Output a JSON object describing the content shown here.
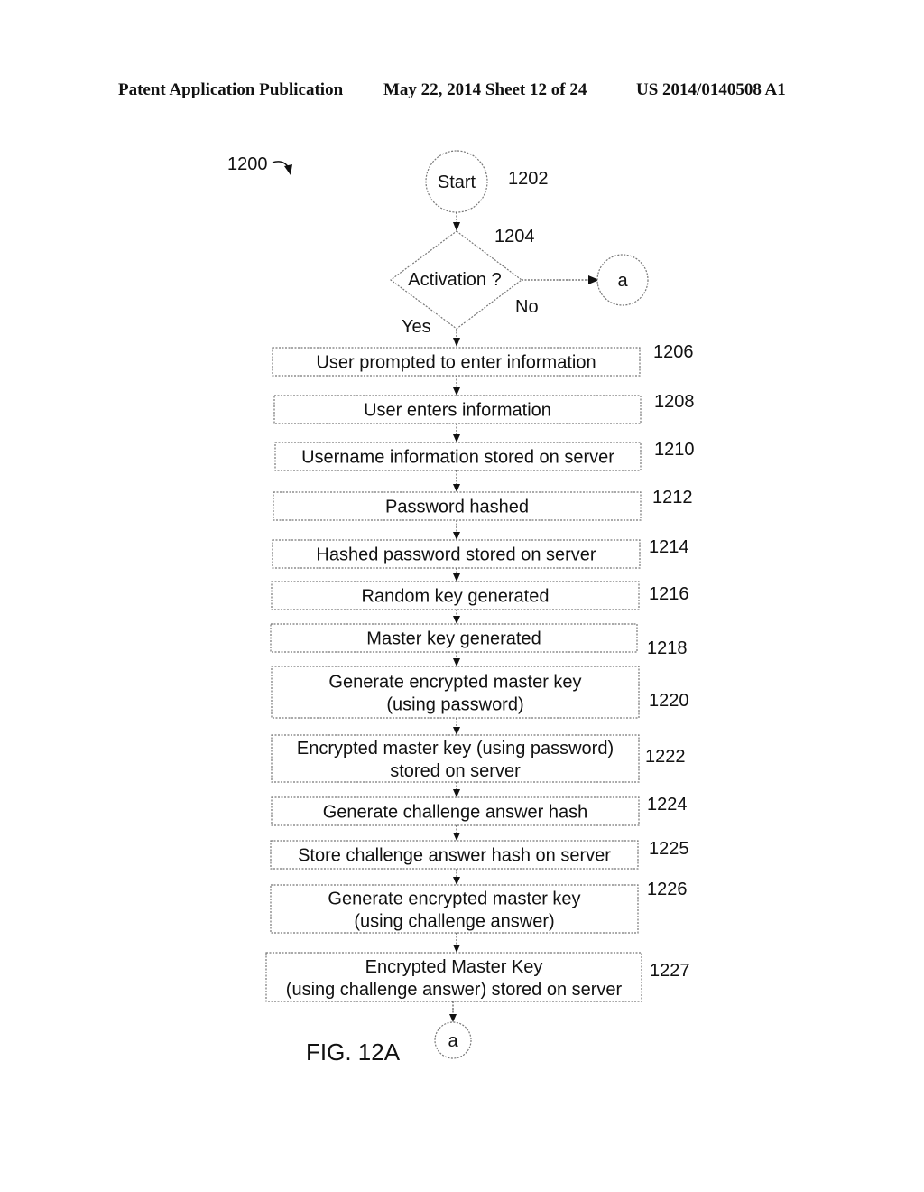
{
  "header": {
    "publication": "Patent Application Publication",
    "date_sheet": "May 22, 2014  Sheet 12 of 24",
    "number": "US 2014/0140508 A1"
  },
  "figure": {
    "label": "FIG. 12A",
    "ref": "1200",
    "start": {
      "text": "Start",
      "ref": "1202"
    },
    "decision": {
      "text": "Activation ?",
      "ref": "1204",
      "yes": "Yes",
      "no": "No"
    },
    "connector_no": "a",
    "connector_end": "a",
    "steps": [
      {
        "ref": "1206",
        "lines": [
          "User prompted to enter information"
        ]
      },
      {
        "ref": "1208",
        "lines": [
          "User enters information"
        ]
      },
      {
        "ref": "1210",
        "lines": [
          "Username information stored on server"
        ]
      },
      {
        "ref": "1212",
        "lines": [
          "Password hashed"
        ]
      },
      {
        "ref": "1214",
        "lines": [
          "Hashed password stored on server"
        ]
      },
      {
        "ref": "1216",
        "lines": [
          "Random key generated"
        ]
      },
      {
        "ref": "1218",
        "lines": [
          "Master key generated"
        ]
      },
      {
        "ref": "1220",
        "lines": [
          "Generate encrypted master key",
          "(using password)"
        ]
      },
      {
        "ref": "1222",
        "lines": [
          "Encrypted master key (using password)",
          "stored on server"
        ]
      },
      {
        "ref": "1224",
        "lines": [
          "Generate challenge answer hash"
        ]
      },
      {
        "ref": "1225",
        "lines": [
          "Store challenge answer hash on server"
        ]
      },
      {
        "ref": "1226",
        "lines": [
          "Generate encrypted master key",
          "(using challenge answer)"
        ]
      },
      {
        "ref": "1227",
        "lines": [
          "Encrypted Master Key",
          "(using challenge answer) stored on server"
        ]
      }
    ]
  }
}
